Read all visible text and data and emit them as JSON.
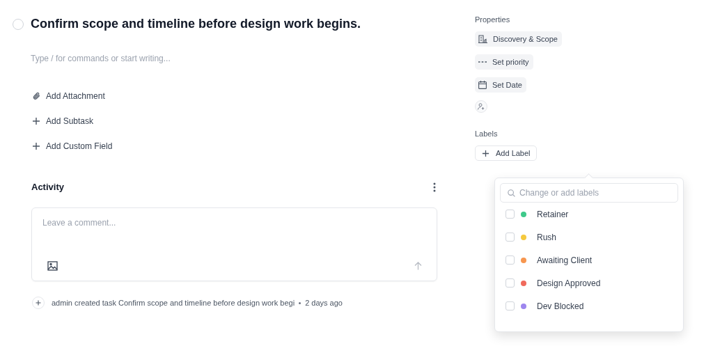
{
  "task": {
    "title": "Confirm scope and timeline before design work begins.",
    "completed": false
  },
  "editor": {
    "placeholder": "Type / for commands or start writing..."
  },
  "actions": [
    {
      "kind": "attachment",
      "label": "Add Attachment"
    },
    {
      "kind": "plus",
      "label": "Add Subtask"
    },
    {
      "kind": "plus",
      "label": "Add Custom Field"
    }
  ],
  "activity": {
    "title": "Activity",
    "comment": {
      "placeholder": "Leave a comment..."
    },
    "events": [
      {
        "text": "admin created task Confirm scope and timeline before design work begi",
        "time": "2 days ago"
      }
    ]
  },
  "properties": {
    "title": "Properties",
    "chips": [
      {
        "kind": "project",
        "label": "Discovery & Scope"
      },
      {
        "kind": "priority",
        "label": "Set priority"
      },
      {
        "kind": "date",
        "label": "Set Date"
      }
    ]
  },
  "labels": {
    "title": "Labels",
    "add_button": "Add Label",
    "popover": {
      "search_placeholder": "Change or add labels",
      "items": [
        {
          "name": "Retainer",
          "color": "#3ec98a",
          "checked": false
        },
        {
          "name": "Rush",
          "color": "#f5c93e",
          "checked": false
        },
        {
          "name": "Awaiting Client",
          "color": "#f7964f",
          "checked": false
        },
        {
          "name": "Design Approved",
          "color": "#f06a5c",
          "checked": false
        },
        {
          "name": "Dev Blocked",
          "color": "#9d86ee",
          "checked": false
        }
      ]
    }
  }
}
